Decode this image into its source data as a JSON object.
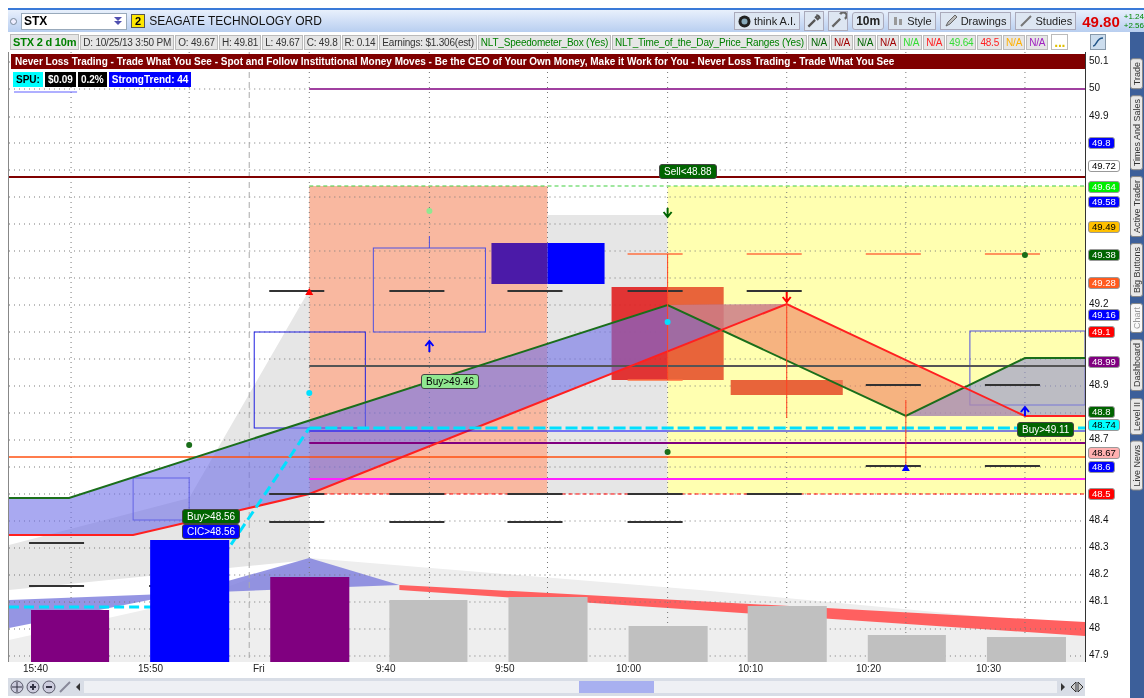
{
  "header": {
    "symbol": "STX",
    "link_badge": "2",
    "company": "SEAGATE TECHNOLOGY ORD",
    "think_ai": "think A.I.",
    "interval": "10m",
    "style": "Style",
    "drawings": "Drawings",
    "studies": "Studies",
    "last_price": "49.80",
    "changes": [
      "+1.24",
      "+2.56"
    ]
  },
  "info_cells": [
    {
      "text": "STX 2 d 10m",
      "color": "#008000"
    },
    {
      "text": "D: 10/25/13 3:50 PM",
      "color": "#333333"
    },
    {
      "text": "O: 49.67",
      "color": "#333333"
    },
    {
      "text": "H: 49.81",
      "color": "#333333"
    },
    {
      "text": "L: 49.67",
      "color": "#333333"
    },
    {
      "text": "C: 49.8",
      "color": "#333333"
    },
    {
      "text": "R: 0.14",
      "color": "#333333"
    },
    {
      "text": "Earnings: $1.306(est)",
      "color": "#333333"
    },
    {
      "text": "NLT_Speedometer_Box (Yes)",
      "color": "#008000"
    },
    {
      "text": "NLT_Time_of_the_Day_Price_Ranges (Yes)",
      "color": "#008000"
    },
    {
      "text": "N/A",
      "color": "#006400"
    },
    {
      "text": "N/A",
      "color": "#a00000"
    },
    {
      "text": "N/A",
      "color": "#006400"
    },
    {
      "text": "N/A",
      "color": "#a00000"
    },
    {
      "text": "N/A",
      "color": "#33dd33"
    },
    {
      "text": "N/A",
      "color": "#ff2020"
    },
    {
      "text": "49.64",
      "color": "#33dd33"
    },
    {
      "text": "48.5",
      "color": "#ff2020"
    },
    {
      "text": "N/A",
      "color": "#ffb000"
    },
    {
      "text": "N/A",
      "color": "#a020c0"
    },
    {
      "text": "...",
      "color": "#e0c000"
    }
  ],
  "banner": "Never Loss Trading - Trade What You See - Spot and Follow Institutional Money Moves - Be the CEO of Your Own Money, Make it Work for You - Never Loss Trading - Trade What You See",
  "badges": [
    {
      "text": "SPU:",
      "color": "#00ffff"
    },
    {
      "text": "$0.09",
      "color": "#000000"
    },
    {
      "text": "0.2%",
      "color": "#000000"
    },
    {
      "text": "StrongTrend: 44",
      "color": "#0000ff"
    }
  ],
  "signals": [
    {
      "text": "Sell<48.88",
      "color": "#006400"
    },
    {
      "text": "Buy>49.46",
      "color": "#90e890"
    },
    {
      "text": "Buy>48.56",
      "color": "#006400"
    },
    {
      "text": "CIC>48.56",
      "color": "#0000ff"
    },
    {
      "text": "Buy>49.11",
      "color": "#006400"
    }
  ],
  "price_axis": {
    "ticks": [
      "50.1",
      "50",
      "49.9",
      "49.2",
      "48.9",
      "48.7",
      "48.4",
      "48.3",
      "48.2",
      "48.1",
      "48",
      "47.9"
    ],
    "tags": [
      {
        "text": "49.8",
        "color": "#0000ff"
      },
      {
        "text": "49.72",
        "color": "#ffffff"
      },
      {
        "text": "49.64",
        "color": "#00ee00"
      },
      {
        "text": "49.58",
        "color": "#0000ff"
      },
      {
        "text": "49.49",
        "color": "#ffc000"
      },
      {
        "text": "49.38",
        "color": "#006400"
      },
      {
        "text": "49.28",
        "color": "#ff5a1e"
      },
      {
        "text": "49.16",
        "color": "#0000ff"
      },
      {
        "text": "49.1",
        "color": "#ff0000"
      },
      {
        "text": "48.99",
        "color": "#800080"
      },
      {
        "text": "48.8",
        "color": "#006400"
      },
      {
        "text": "48.74",
        "color": "#00ffff"
      },
      {
        "text": "48.67",
        "color": "#ffb0b0"
      },
      {
        "text": "48.6",
        "color": "#0000ff"
      },
      {
        "text": "48.5",
        "color": "#ff0000"
      }
    ]
  },
  "time_axis": [
    "15:40",
    "15:50",
    "Fri",
    "9:40",
    "9:50",
    "10:00",
    "10:10",
    "10:20",
    "10:30"
  ],
  "side_tabs": [
    {
      "label": "Trade",
      "selected": false
    },
    {
      "label": "Times And Sales",
      "selected": false
    },
    {
      "label": "Active Trader",
      "selected": false
    },
    {
      "label": "Big Buttons",
      "selected": false
    },
    {
      "label": "Chart",
      "selected": true
    },
    {
      "label": "Dashboard",
      "selected": false
    },
    {
      "label": "Level II",
      "selected": false
    },
    {
      "label": "Live News",
      "selected": false
    }
  ]
}
